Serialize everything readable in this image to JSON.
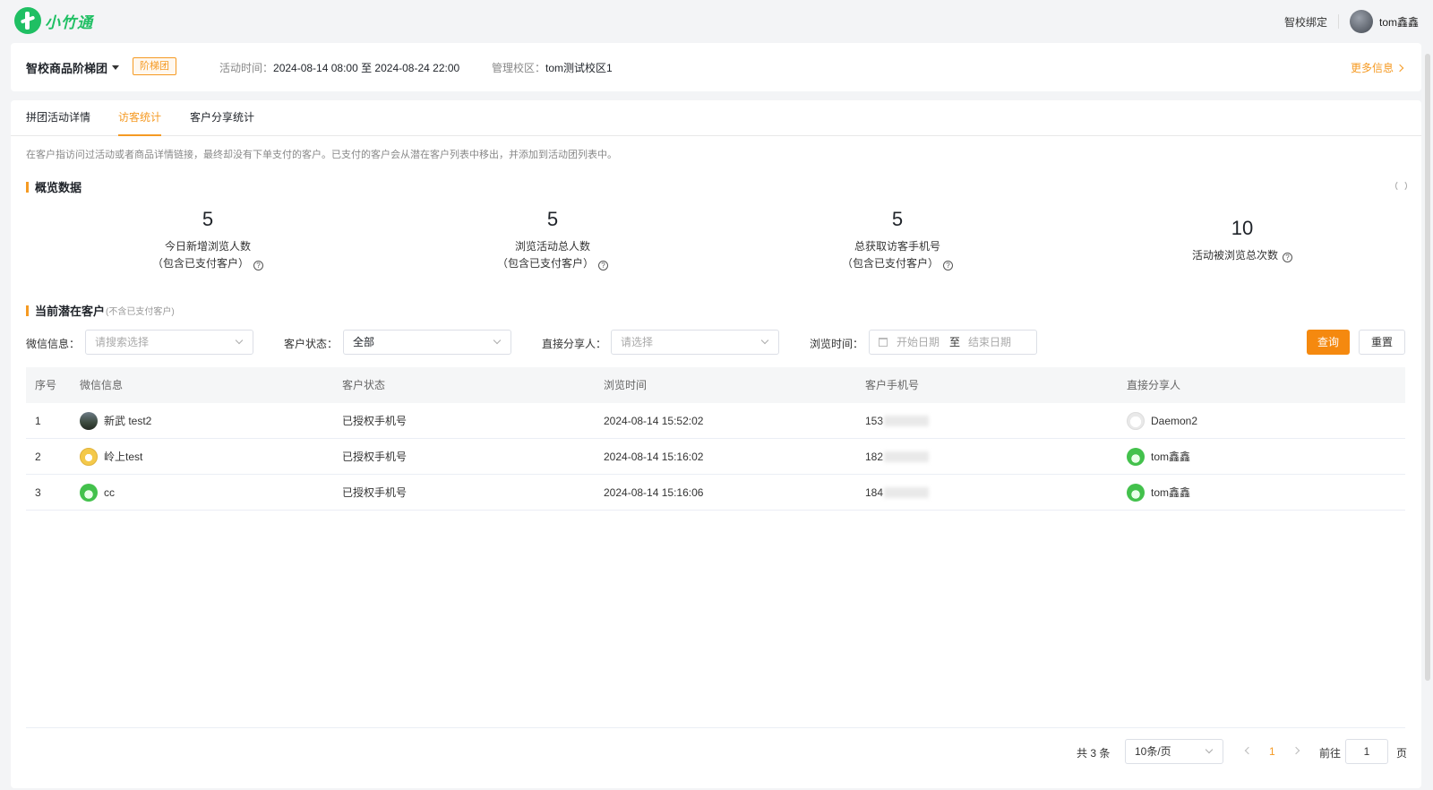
{
  "header": {
    "logo_text": "小竹通",
    "bind_school": "智校绑定",
    "user_name": "tom鑫鑫"
  },
  "activity": {
    "name": "智校商品阶梯团",
    "tag": "阶梯团",
    "time_label": "活动时间：",
    "time_value": "2024-08-14 08:00 至 2024-08-24 22:00",
    "campus_label": "管理校区：",
    "campus_value": "tom测试校区1",
    "more": "更多信息"
  },
  "tabs": [
    {
      "label": "拼团活动详情",
      "active": false
    },
    {
      "label": "访客统计",
      "active": true
    },
    {
      "label": "客户分享统计",
      "active": false
    }
  ],
  "notice": "在客户指访问过活动或者商品详情链接，最终却没有下单支付的客户。已支付的客户会从潜在客户列表中移出，并添加到活动团列表中。",
  "overview": {
    "title": "概览数据",
    "stats": [
      {
        "value": "5",
        "label": "今日新增浏览人数",
        "sub": "（包含已支付客户）"
      },
      {
        "value": "5",
        "label": "浏览活动总人数",
        "sub": "（包含已支付客户）"
      },
      {
        "value": "5",
        "label": "总获取访客手机号",
        "sub": "（包含已支付客户）"
      },
      {
        "value": "10",
        "label": "活动被浏览总次数",
        "sub": ""
      }
    ]
  },
  "potential": {
    "title": "当前潜在客户",
    "subtitle": "(不含已支付客户)"
  },
  "filters": {
    "wechat_label": "微信信息：",
    "wechat_placeholder": "请搜索选择",
    "status_label": "客户状态：",
    "status_value": "全部",
    "sharer_label": "直接分享人：",
    "sharer_placeholder": "请选择",
    "time_label": "浏览时间：",
    "date_start": "开始日期",
    "date_sep": "至",
    "date_end": "结束日期",
    "query": "查询",
    "reset": "重置"
  },
  "table": {
    "columns": [
      "序号",
      "微信信息",
      "客户状态",
      "浏览时间",
      "客户手机号",
      "直接分享人"
    ],
    "rows": [
      {
        "idx": "1",
        "wechat": "新武 test2",
        "avatar": "dark",
        "status": "已授权手机号",
        "time": "2024-08-14 15:52:02",
        "phone": "153",
        "sharer": "Daemon2",
        "sharer_avatar": "white"
      },
      {
        "idx": "2",
        "wechat": "岭上test",
        "avatar": "yellow",
        "status": "已授权手机号",
        "time": "2024-08-14 15:16:02",
        "phone": "182",
        "sharer": "tom鑫鑫",
        "sharer_avatar": "green"
      },
      {
        "idx": "3",
        "wechat": "cc",
        "avatar": "green",
        "status": "已授权手机号",
        "time": "2024-08-14 15:16:06",
        "phone": "184",
        "sharer": "tom鑫鑫",
        "sharer_avatar": "green"
      }
    ]
  },
  "pager": {
    "total": "共 3 条",
    "page_size": "10条/页",
    "current": "1",
    "goto_label": "前往",
    "goto_value": "1",
    "page_suffix": "页"
  }
}
